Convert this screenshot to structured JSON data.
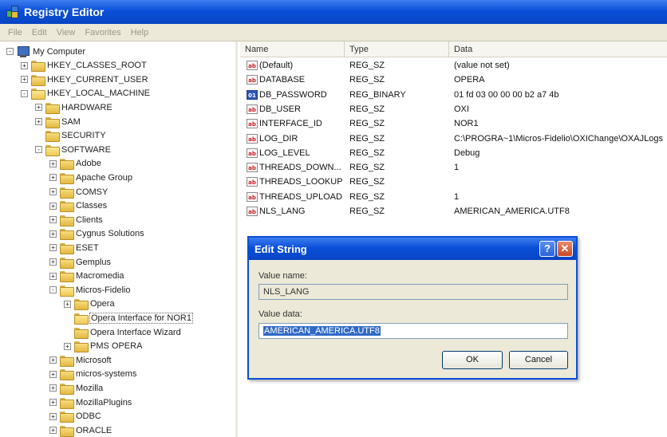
{
  "window": {
    "title": "Registry Editor"
  },
  "menu": [
    "File",
    "Edit",
    "View",
    "Favorites",
    "Help"
  ],
  "tree": [
    {
      "label": "My Computer",
      "depth": 0,
      "expander": "-",
      "icon": "computer"
    },
    {
      "label": "HKEY_CLASSES_ROOT",
      "depth": 1,
      "expander": "+",
      "icon": "folder"
    },
    {
      "label": "HKEY_CURRENT_USER",
      "depth": 1,
      "expander": "+",
      "icon": "folder"
    },
    {
      "label": "HKEY_LOCAL_MACHINE",
      "depth": 1,
      "expander": "-",
      "icon": "folder-open"
    },
    {
      "label": "HARDWARE",
      "depth": 2,
      "expander": "+",
      "icon": "folder"
    },
    {
      "label": "SAM",
      "depth": 2,
      "expander": "+",
      "icon": "folder"
    },
    {
      "label": "SECURITY",
      "depth": 2,
      "expander": "",
      "icon": "folder"
    },
    {
      "label": "SOFTWARE",
      "depth": 2,
      "expander": "-",
      "icon": "folder-open"
    },
    {
      "label": "Adobe",
      "depth": 3,
      "expander": "+",
      "icon": "folder"
    },
    {
      "label": "Apache Group",
      "depth": 3,
      "expander": "+",
      "icon": "folder"
    },
    {
      "label": "COMSY",
      "depth": 3,
      "expander": "+",
      "icon": "folder"
    },
    {
      "label": "Classes",
      "depth": 3,
      "expander": "+",
      "icon": "folder"
    },
    {
      "label": "Clients",
      "depth": 3,
      "expander": "+",
      "icon": "folder"
    },
    {
      "label": "Cygnus Solutions",
      "depth": 3,
      "expander": "+",
      "icon": "folder"
    },
    {
      "label": "ESET",
      "depth": 3,
      "expander": "+",
      "icon": "folder"
    },
    {
      "label": "Gemplus",
      "depth": 3,
      "expander": "+",
      "icon": "folder"
    },
    {
      "label": "Macromedia",
      "depth": 3,
      "expander": "+",
      "icon": "folder"
    },
    {
      "label": "Micros-Fidelio",
      "depth": 3,
      "expander": "-",
      "icon": "folder-open"
    },
    {
      "label": "Opera",
      "depth": 4,
      "expander": "+",
      "icon": "folder"
    },
    {
      "label": "Opera Interface for NOR1",
      "depth": 4,
      "expander": "",
      "icon": "folder-open",
      "selected": true
    },
    {
      "label": "Opera Interface Wizard",
      "depth": 4,
      "expander": "",
      "icon": "folder"
    },
    {
      "label": "PMS OPERA",
      "depth": 4,
      "expander": "+",
      "icon": "folder"
    },
    {
      "label": "Microsoft",
      "depth": 3,
      "expander": "+",
      "icon": "folder"
    },
    {
      "label": "micros-systems",
      "depth": 3,
      "expander": "+",
      "icon": "folder"
    },
    {
      "label": "Mozilla",
      "depth": 3,
      "expander": "+",
      "icon": "folder"
    },
    {
      "label": "MozillaPlugins",
      "depth": 3,
      "expander": "+",
      "icon": "folder"
    },
    {
      "label": "ODBC",
      "depth": 3,
      "expander": "+",
      "icon": "folder"
    },
    {
      "label": "ORACLE",
      "depth": 3,
      "expander": "+",
      "icon": "folder"
    }
  ],
  "list": {
    "columns": [
      "Name",
      "Type",
      "Data"
    ],
    "rows": [
      {
        "name": "(Default)",
        "type": "REG_SZ",
        "data": "(value not set)",
        "icon": "sz"
      },
      {
        "name": "DATABASE",
        "type": "REG_SZ",
        "data": "OPERA",
        "icon": "sz"
      },
      {
        "name": "DB_PASSWORD",
        "type": "REG_BINARY",
        "data": "01 fd 03 00 00 00 b2 a7 4b",
        "icon": "bin"
      },
      {
        "name": "DB_USER",
        "type": "REG_SZ",
        "data": "OXI",
        "icon": "sz"
      },
      {
        "name": "INTERFACE_ID",
        "type": "REG_SZ",
        "data": "NOR1",
        "icon": "sz"
      },
      {
        "name": "LOG_DIR",
        "type": "REG_SZ",
        "data": "C:\\PROGRA~1\\Micros-Fidelio\\OXIChange\\OXAJLogs",
        "icon": "sz"
      },
      {
        "name": "LOG_LEVEL",
        "type": "REG_SZ",
        "data": "Debug",
        "icon": "sz"
      },
      {
        "name": "THREADS_DOWN...",
        "type": "REG_SZ",
        "data": "1",
        "icon": "sz"
      },
      {
        "name": "THREADS_LOOKUP",
        "type": "REG_SZ",
        "data": "",
        "icon": "sz"
      },
      {
        "name": "THREADS_UPLOAD",
        "type": "REG_SZ",
        "data": "1",
        "icon": "sz"
      },
      {
        "name": "NLS_LANG",
        "type": "REG_SZ",
        "data": "AMERICAN_AMERICA.UTF8",
        "icon": "sz"
      }
    ]
  },
  "dialog": {
    "title": "Edit String",
    "help": "?",
    "close": "✕",
    "value_name_label": "Value name:",
    "value_name": "NLS_LANG",
    "value_data_label": "Value data:",
    "value_data": "AMERICAN_AMERICA.UTF8",
    "ok": "OK",
    "cancel": "Cancel"
  }
}
